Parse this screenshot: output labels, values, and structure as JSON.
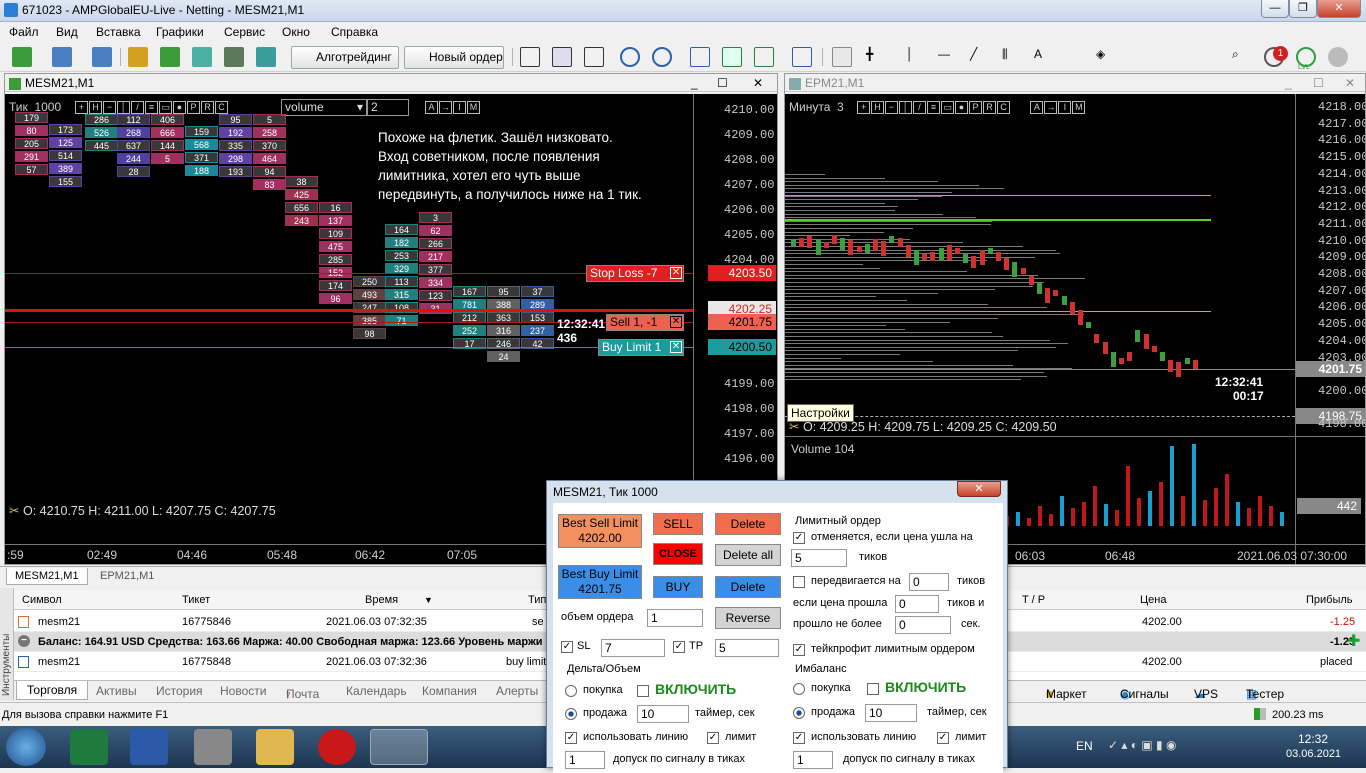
{
  "window": {
    "title": "671023 - AMPGlobalEU-Live - Netting - MESM21,M1"
  },
  "menu": [
    "Файл",
    "Вид",
    "Вставка",
    "Графики",
    "Сервис",
    "Окно",
    "Справка"
  ],
  "toolbar": {
    "algo": "Алготрейдинг",
    "new_order": "Новый ордер",
    "notif_count": "1",
    "lvl": "LVL"
  },
  "left_chart": {
    "tab": "MESM21,M1",
    "mode": "Тик",
    "ticks": "1000",
    "indicator": "volume",
    "step": "2",
    "note": [
      "Похоже на флетик. Зашёл низковато.",
      "Вход советником, после появления",
      "лимитника, хотел его чуть выше",
      "передвинуть, а получилось ниже на 1 тик."
    ],
    "prices": [
      "4210.00",
      "4209.00",
      "4208.00",
      "4207.00",
      "4206.00",
      "4205.00",
      "4204.00",
      "4203.50",
      "4202.25",
      "4201.75",
      "4200.50",
      "4199.00",
      "4198.00",
      "4197.00",
      "4196.00"
    ],
    "stop_loss": "Stop Loss  -7",
    "sell": "Sell  1,  -1",
    "buy_limit": "Buy Limit  1",
    "clock": "12:32:41",
    "clock2": "436",
    "ohlc": "O: 4210.75   H: 4211.00   L: 4207.75   C: 4207.75",
    "times": [
      ":59",
      "02:49",
      "04:46",
      "05:48",
      "06:42",
      "07:05"
    ],
    "colors": {
      "stop": "#e02020",
      "buy": "#1a9c9c",
      "sell": "#f06050"
    }
  },
  "right_chart": {
    "tab": "EPM21,M1",
    "mode": "Минута",
    "step": "3",
    "prices": [
      "4218.00",
      "4217.00",
      "4216.00",
      "4215.00",
      "4214.00",
      "4213.00",
      "4212.00",
      "4211.00",
      "4210.00",
      "4209.00",
      "4208.00",
      "4207.00",
      "4206.00",
      "4205.00",
      "4204.00",
      "4203.00",
      "4201.75",
      "4200.00",
      "4198.75",
      "4198.00"
    ],
    "clock": "12:32:41",
    "timer": "00:17",
    "tooltip": "Настройки",
    "ohlc": "O: 4209.25   H: 4209.75   L: 4209.25   C: 4209.50",
    "volume_label": "Volume 104",
    "volume_value": "442",
    "times": [
      "06:03",
      "06:48",
      "2021.06.03 07:30:00"
    ]
  },
  "chart_tabs": [
    "MESM21,M1",
    "EPM21,M1"
  ],
  "terminal": {
    "headers": [
      "Символ",
      "Тикет",
      "Время",
      "Тип",
      "T / P",
      "Цена",
      "Прибыль"
    ],
    "rows": [
      {
        "symbol": "mesm21",
        "ticket": "16775846",
        "time": "2021.06.03 07:32:35",
        "type": "sell",
        "price": "4202.00",
        "profit": "-1.25"
      },
      {
        "symbol": "mesm21",
        "ticket": "16775848",
        "time": "2021.06.03 07:32:36",
        "type": "buy limit",
        "price": "4202.00",
        "profit": "placed"
      }
    ],
    "balance": "Баланс: 164.91 USD   Средства: 163.66   Маржа: 40.00   Свободная маржа: 123.66   Уровень маржи",
    "balance_profit": "-1.25",
    "side_label": "Инструменты"
  },
  "bottom_tabs": [
    "Торговля",
    "Активы",
    "История",
    "Новости",
    "Почта",
    "Календарь",
    "Компания",
    "Алерты"
  ],
  "mail_count": "7",
  "bottom_right": [
    "Маркет",
    "Сигналы",
    "VPS",
    "Тестер стратегий"
  ],
  "status": {
    "help": "Для вызова справки нажмите F1",
    "ping": "200.23 ms"
  },
  "dialog": {
    "title": "MESM21, Тик  1000",
    "best_sell": "Best Sell Limit",
    "best_sell_price": "4202.00",
    "best_buy": "Best Buy Limit",
    "best_buy_price": "4201.75",
    "sell": "SELL",
    "close": "CLOSE",
    "buy": "BUY",
    "delete": "Delete",
    "delete_all": "Delete all",
    "reverse": "Reverse",
    "volume_label": "объем ордера",
    "volume": "1",
    "sl": "SL",
    "sl_val": "7",
    "tp": "TP",
    "tp_val": "5",
    "limit_title": "Лимитный ордер",
    "cancel_if": "отменяется, если цена ушла на",
    "cancel_val": "5",
    "ticks": "тиков",
    "moved": "передвигается на",
    "moved_val": "0",
    "moved_ticks": "тиков",
    "if_passed": "если цена прошла",
    "passed_val": "0",
    "ticks_and": "тиков и",
    "passed_no_more": "прошло не более",
    "sec_val": "0",
    "sec": "сек.",
    "tp_limit": "тейкпрофит лимитным ордером",
    "delta_title": "Дельта/Объем",
    "imb_title": "Имбаланс",
    "buy_lbl": "покупка",
    "sell_lbl": "продажа",
    "enable": "ВКЛЮЧИТЬ",
    "timer_val": "10",
    "timer": "таймер, сек",
    "use_line": "использовать линию",
    "limit": "лимит",
    "tol_val": "1",
    "tol": "допуск по сигналу в тиках"
  },
  "taskbar": {
    "lang": "EN",
    "time": "12:32",
    "date": "03.06.2021"
  }
}
